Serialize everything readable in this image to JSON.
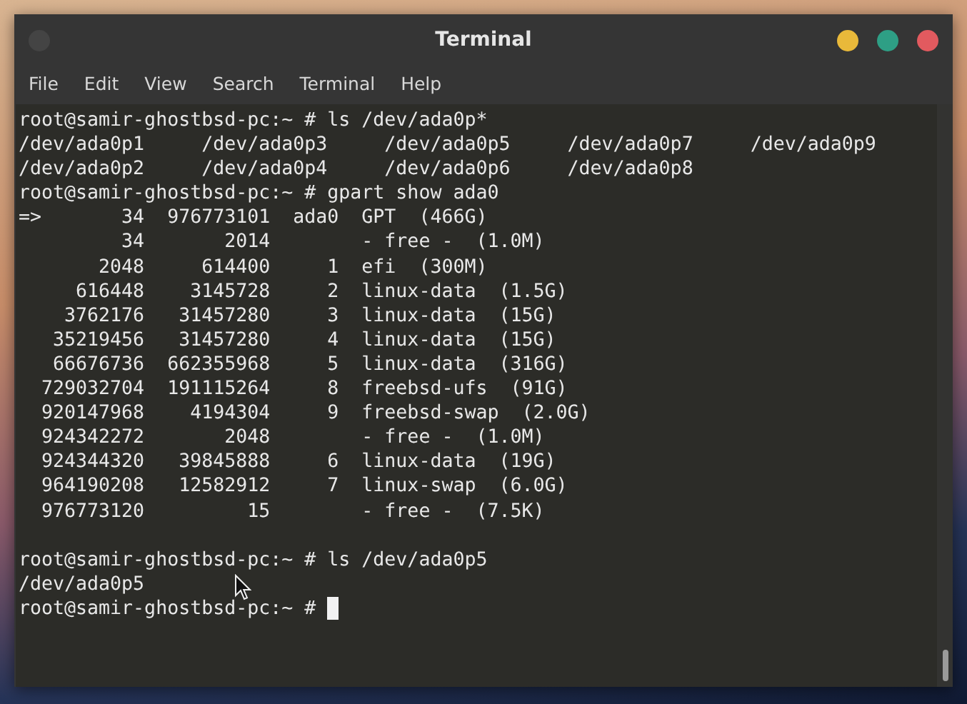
{
  "window": {
    "title": "Terminal"
  },
  "menu": [
    "File",
    "Edit",
    "View",
    "Search",
    "Terminal",
    "Help"
  ],
  "terminal": {
    "lines": [
      {
        "kind": "text",
        "text": "root@samir-ghostbsd-pc:~ # ls /dev/ada0p*"
      },
      {
        "kind": "text",
        "text": "/dev/ada0p1     /dev/ada0p3     /dev/ada0p5     /dev/ada0p7     /dev/ada0p9"
      },
      {
        "kind": "text",
        "text": "/dev/ada0p2     /dev/ada0p4     /dev/ada0p6     /dev/ada0p8"
      },
      {
        "kind": "text",
        "text": "root@samir-ghostbsd-pc:~ # gpart show ada0"
      },
      {
        "kind": "text",
        "text": "=>       34  976773101  ada0  GPT  (466G)"
      },
      {
        "kind": "text",
        "text": "         34       2014        - free -  (1.0M)"
      },
      {
        "kind": "text",
        "text": "       2048     614400     1  efi  (300M)"
      },
      {
        "kind": "text",
        "text": "     616448    3145728     2  linux-data  (1.5G)"
      },
      {
        "kind": "text",
        "text": "    3762176   31457280     3  linux-data  (15G)"
      },
      {
        "kind": "text",
        "text": "   35219456   31457280     4  linux-data  (15G)"
      },
      {
        "kind": "text",
        "text": "   66676736  662355968     5  linux-data  (316G)"
      },
      {
        "kind": "text",
        "text": "  729032704  191115264     8  freebsd-ufs  (91G)"
      },
      {
        "kind": "text",
        "text": "  920147968    4194304     9  freebsd-swap  (2.0G)"
      },
      {
        "kind": "text",
        "text": "  924342272       2048        - free -  (1.0M)"
      },
      {
        "kind": "text",
        "text": "  924344320   39845888     6  linux-data  (19G)"
      },
      {
        "kind": "text",
        "text": "  964190208   12582912     7  linux-swap  (6.0G)"
      },
      {
        "kind": "text",
        "text": "  976773120         15        - free -  (7.5K)"
      },
      {
        "kind": "blank"
      },
      {
        "kind": "text",
        "text": "root@samir-ghostbsd-pc:~ # ls /dev/ada0p5"
      },
      {
        "kind": "text",
        "text": "/dev/ada0p5"
      },
      {
        "kind": "prompt_cursor",
        "text": "root@samir-ghostbsd-pc:~ # "
      }
    ]
  }
}
